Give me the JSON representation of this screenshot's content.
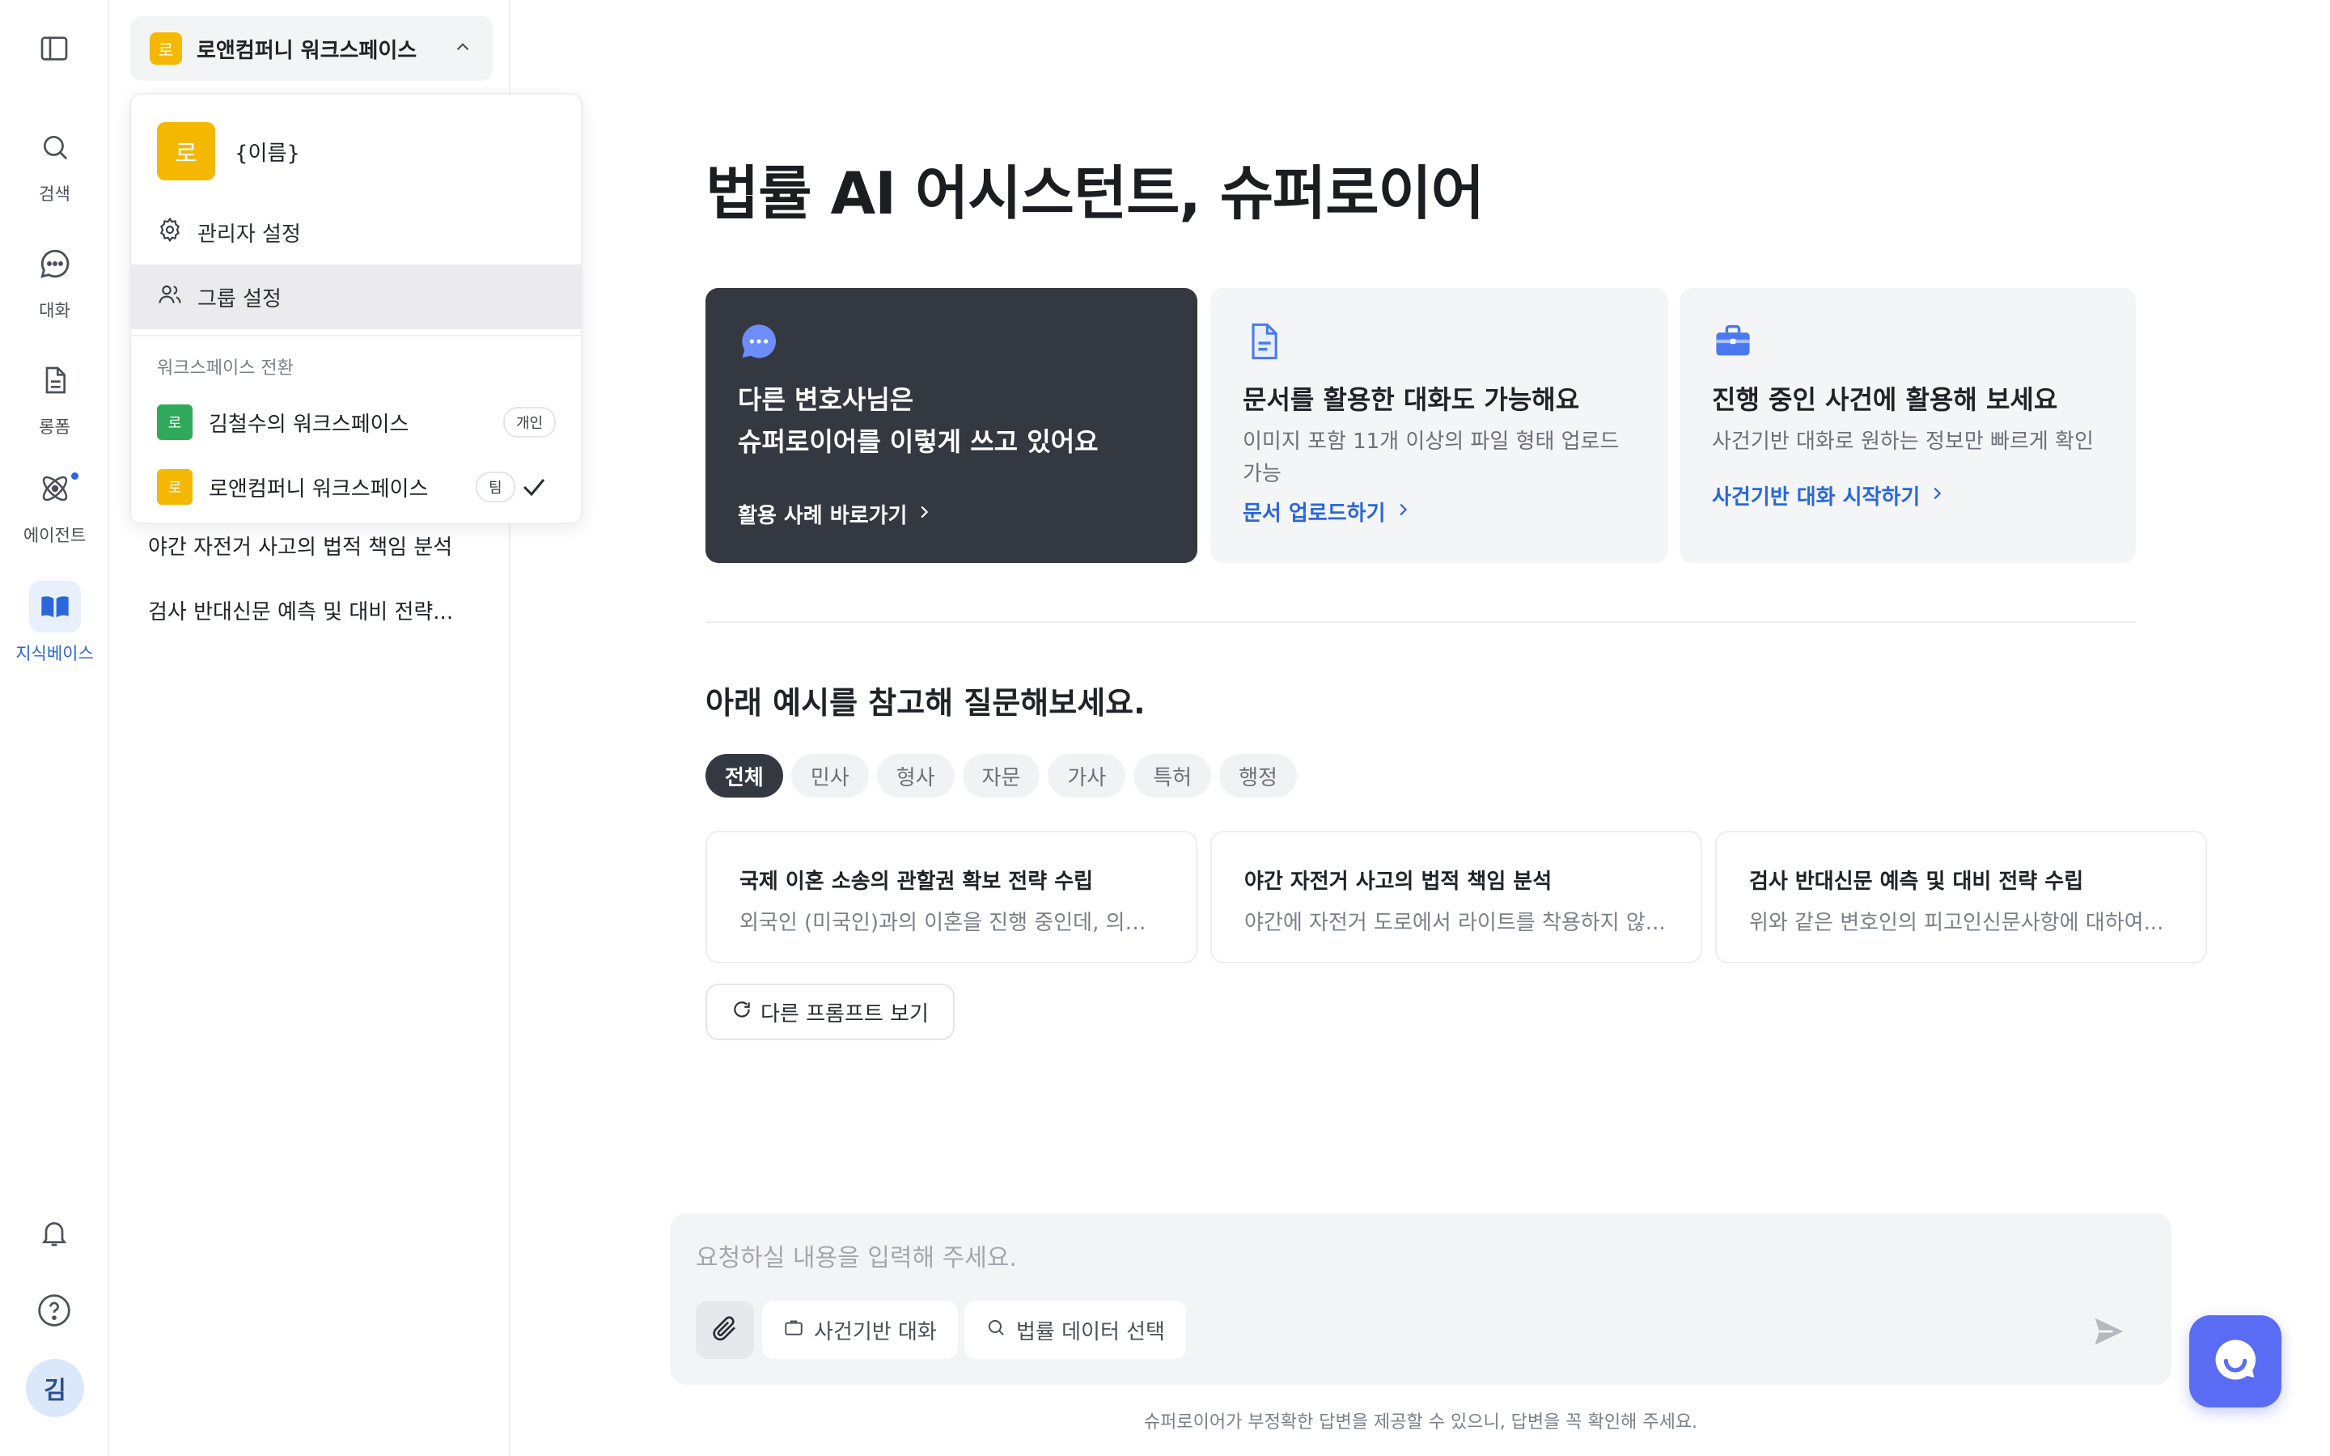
{
  "rail": {
    "items": [
      {
        "label": "검색"
      },
      {
        "label": "대화"
      },
      {
        "label": "롱폼"
      },
      {
        "label": "에이전트"
      },
      {
        "label": "지식베이스"
      }
    ],
    "avatar": "김"
  },
  "panel": {
    "workspace_badge": "로",
    "workspace_name": "로앤컴퍼니 워크스페이스",
    "history": [
      "야간 자전거 사고의 법적 책임 분석",
      "검사 반대신문 예측 및 대비 전략..."
    ]
  },
  "dropdown": {
    "badge": "로",
    "name": "{이름}",
    "admin_settings": "관리자 설정",
    "group_settings": "그룹 설정",
    "section_label": "워크스페이스 전환",
    "workspaces": [
      {
        "badge": "로",
        "name": "김철수의 워크스페이스",
        "tag": "개인",
        "color": "#2eaa5a"
      },
      {
        "badge": "로",
        "name": "로앤컴퍼니 워크스페이스",
        "tag": "팀",
        "color": "#f5b800"
      }
    ]
  },
  "main": {
    "title": "법률 AI 어시스턴트, 슈퍼로이어",
    "cards": [
      {
        "title_line1": "다른 변호사님은",
        "title_line2": "슈퍼로이어를 이렇게 쓰고 있어요",
        "link": "활용 사례 바로가기"
      },
      {
        "title": "문서를 활용한 대화도 가능해요",
        "desc": "이미지 포함 11개 이상의 파일 형태 업로드 가능",
        "link": "문서 업로드하기"
      },
      {
        "title": "진행 중인 사건에 활용해 보세요",
        "desc": "사건기반 대화로 원하는 정보만 빠르게 확인",
        "link": "사건기반 대화 시작하기"
      }
    ],
    "section_title": "아래 예시를 참고해 질문해보세요.",
    "tabs": [
      "전체",
      "민사",
      "형사",
      "자문",
      "가사",
      "특허",
      "행정"
    ],
    "examples": [
      {
        "title": "국제 이혼 소송의 관할권 확보 전략 수립",
        "snippet": "외국인 (미국인)과의 이혼을 진행 중인데, 의뢰..."
      },
      {
        "title": "야간 자전거 사고의 법적 책임 분석",
        "snippet": "야간에 자전거 도로에서 라이트를 착용하지 않..."
      },
      {
        "title": "검사 반대신문 예측 및 대비 전략 수립",
        "snippet": "위와 같은 변호인의 피고인신문사항에 대하여..."
      }
    ],
    "more_prompts": "다른 프롬프트 보기"
  },
  "composer": {
    "placeholder": "요청하실 내용을 입력해 주세요.",
    "case_chat": "사건기반 대화",
    "legal_data": "법률 데이터 선택"
  },
  "footer_note": "슈퍼로이어가 부정확한 답변을 제공할 수 있으니, 답변을 꼭 확인해 주세요.",
  "colors": {
    "accent": "#2b67d9",
    "dark_card": "#343840",
    "badge_yellow": "#f5b800",
    "badge_green": "#2eaa5a",
    "fab": "#5b6cf4"
  }
}
